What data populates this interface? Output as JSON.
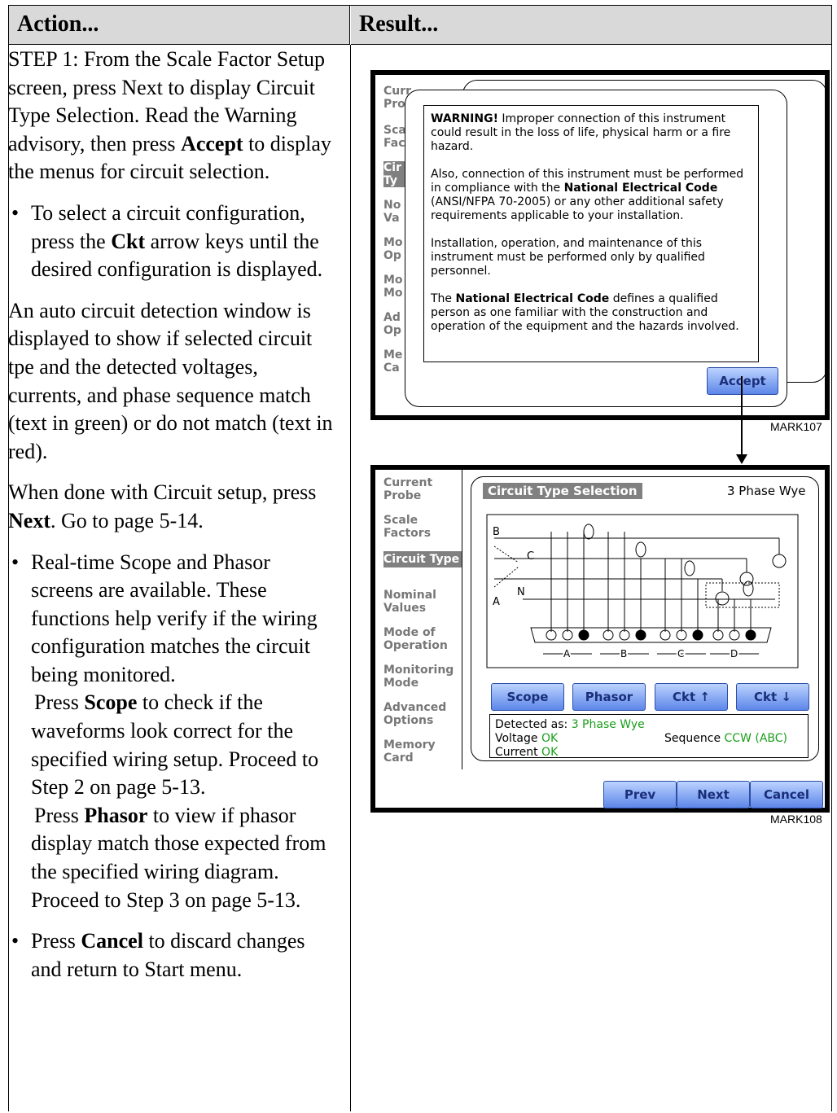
{
  "table": {
    "header_action": "Action...",
    "header_result": "Result..."
  },
  "action": {
    "step1_pre": "STEP 1: From the Scale Factor Setup screen, press Next to display Circuit Type Selection. Read the Warning advisory, then press ",
    "step1_bold": "Accept",
    "step1_post": " to display the menus for circuit selection.",
    "b1_pre": "To select a circuit configuration, press the ",
    "b1_bold": "Ckt",
    "b1_post": " arrow keys until the desired configuration is displayed.",
    "p2": "An auto circuit detection window is displayed to show if selected circuit tpe and the detected voltages, currents, and phase sequence match (text in green) or do not match (text in red).",
    "p3_pre": "When done with Circuit setup, press ",
    "p3_bold": "Next",
    "p3_post": ". Go to page 5-14.",
    "b2_text": "Real-time Scope and Phasor screens are available. These functions help verify if the wiring configuration matches the circuit being monitored.",
    "b2_scope_pre": "Press ",
    "b2_scope_bold": "Scope",
    "b2_scope_post": " to check if the waveforms look correct for the specified wiring setup. Proceed to Step 2 on page 5-13.",
    "b2_phasor_pre": "Press ",
    "b2_phasor_bold": "Phasor",
    "b2_phasor_post": " to view if phasor display match those expected from the specified wiring diagram. Proceed to Step 3 on page 5-13.",
    "b3_pre": "Press ",
    "b3_bold": "Cancel",
    "b3_post": " to discard changes and return to Start menu."
  },
  "screen1": {
    "mark": "MARK107",
    "side_partial": [
      "Curr",
      "Pro",
      "Sca",
      "Fac",
      "Cir",
      "Ty",
      "No",
      "Va",
      "Mo",
      "Op",
      "Mo",
      "Mo",
      "Ad",
      "Op",
      "Me",
      "Ca"
    ],
    "warning_title": "WARNING!",
    "warning_l1": " Improper connection of this instrument could result in the loss of life, physical harm or a fire hazard.",
    "warning_l2_pre": "Also, connection of this instrument must be performed in compliance with the ",
    "warning_l2_bold": "National Electrical Code",
    "warning_l2_post": " (ANSI/NFPA 70-2005) or any other additional safety requirements applicable to your installation.",
    "warning_l3": "Installation, operation, and maintenance of this instrument must be performed only by qualified personnel.",
    "warning_l4_pre": "The ",
    "warning_l4_bold": "National Electrical Code",
    "warning_l4_post": " defines a qualified person as one familiar with the construction and operation of the equipment and the hazards involved.",
    "accept_label": "Accept"
  },
  "screen2": {
    "mark": "MARK108",
    "side": [
      "Current Probe",
      "Scale Factors",
      "Circuit Type",
      "Nominal Values",
      "Mode of Operation",
      "Monitoring Mode",
      "Advanced Options",
      "Memory Card"
    ],
    "title": "Circuit Type Selection",
    "circuit_name": "3 Phase Wye",
    "buttons": [
      "Scope",
      "Phasor",
      "Ckt ↑",
      "Ckt ↓"
    ],
    "detected_label": "Detected as:",
    "detected_value": "3 Phase Wye",
    "voltage_label": "Voltage",
    "voltage_value": "OK",
    "current_label": "Current",
    "current_value": "OK",
    "sequence_label": "Sequence",
    "sequence_value": "CCW (ABC)",
    "nav": [
      "Prev",
      "Next",
      "Cancel"
    ],
    "diagram_labels": {
      "B": "B",
      "C": "C",
      "N": "N",
      "A": "A",
      "groups": [
        "A",
        "B",
        "C",
        "D"
      ]
    }
  },
  "colors": {
    "header_bg": "#d9d9d9",
    "button": "#5c86e8",
    "ok_green": "#1a9e1a",
    "selected_side": "#808080"
  }
}
